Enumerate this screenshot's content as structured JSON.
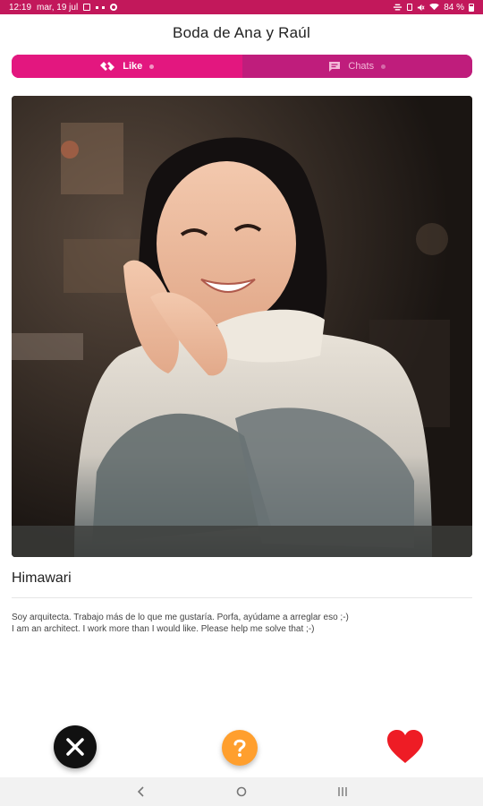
{
  "status_bar": {
    "time": "12:19",
    "date": "mar, 19 jul",
    "battery": "84 %"
  },
  "header": {
    "title": "Boda de Ana y Raúl"
  },
  "tabs": [
    {
      "label": "Like",
      "icon": "hands-icon",
      "active": true
    },
    {
      "label": "Chats",
      "icon": "chat-icon",
      "active": false
    }
  ],
  "profile": {
    "name": "Himawari",
    "bio_es": "Soy arquitecta. Trabajo más de lo que me gustaría. Porfa, ayúdame a arreglar eso ;-)",
    "bio_en": "I am an architect. I work more than I would like. Please help me solve that ;-)"
  },
  "actions": {
    "dislike_icon": "close-icon",
    "help_icon": "question-icon",
    "like_icon": "heart-icon"
  },
  "nav": {
    "back_icon": "back-chevron-icon",
    "home_icon": "home-circle-icon",
    "recents_icon": "recents-bars-icon"
  },
  "colors": {
    "accent": "#e3177f",
    "status_bar": "#c2185b",
    "help": "#ff9f2e",
    "like": "#ee1c25",
    "dislike": "#111111"
  }
}
